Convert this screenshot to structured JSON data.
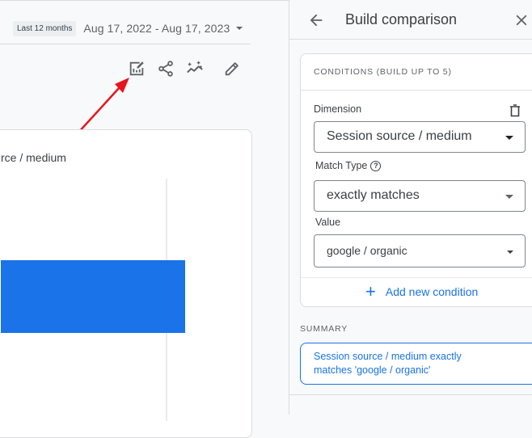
{
  "date_picker": {
    "preset_label": "Last 12 months",
    "range": "Aug 17, 2022 - Aug 17, 2023"
  },
  "toolbar": {
    "icons": [
      "customize-report-icon",
      "share-icon",
      "insights-icon",
      "edit-icon"
    ]
  },
  "report_card": {
    "title_partial": "rce / medium",
    "bar_color": "#1a73e8"
  },
  "panel": {
    "title": "Build comparison",
    "conditions_header": "CONDITIONS (BUILD UP TO 5)",
    "dimension": {
      "label": "Dimension",
      "value": "Session source / medium"
    },
    "match_type": {
      "label": "Match Type",
      "help_glyph": "?",
      "value": "exactly matches"
    },
    "value_field": {
      "label": "Value",
      "value": "google / organic"
    },
    "add_condition_label": "Add new condition",
    "add_condition_glyph": "+",
    "summary_label": "SUMMARY",
    "summary_text": "Session source / medium exactly matches 'google / organic'"
  },
  "colors": {
    "accent": "#1a73e8",
    "annotation_arrow": "#e8141c"
  }
}
